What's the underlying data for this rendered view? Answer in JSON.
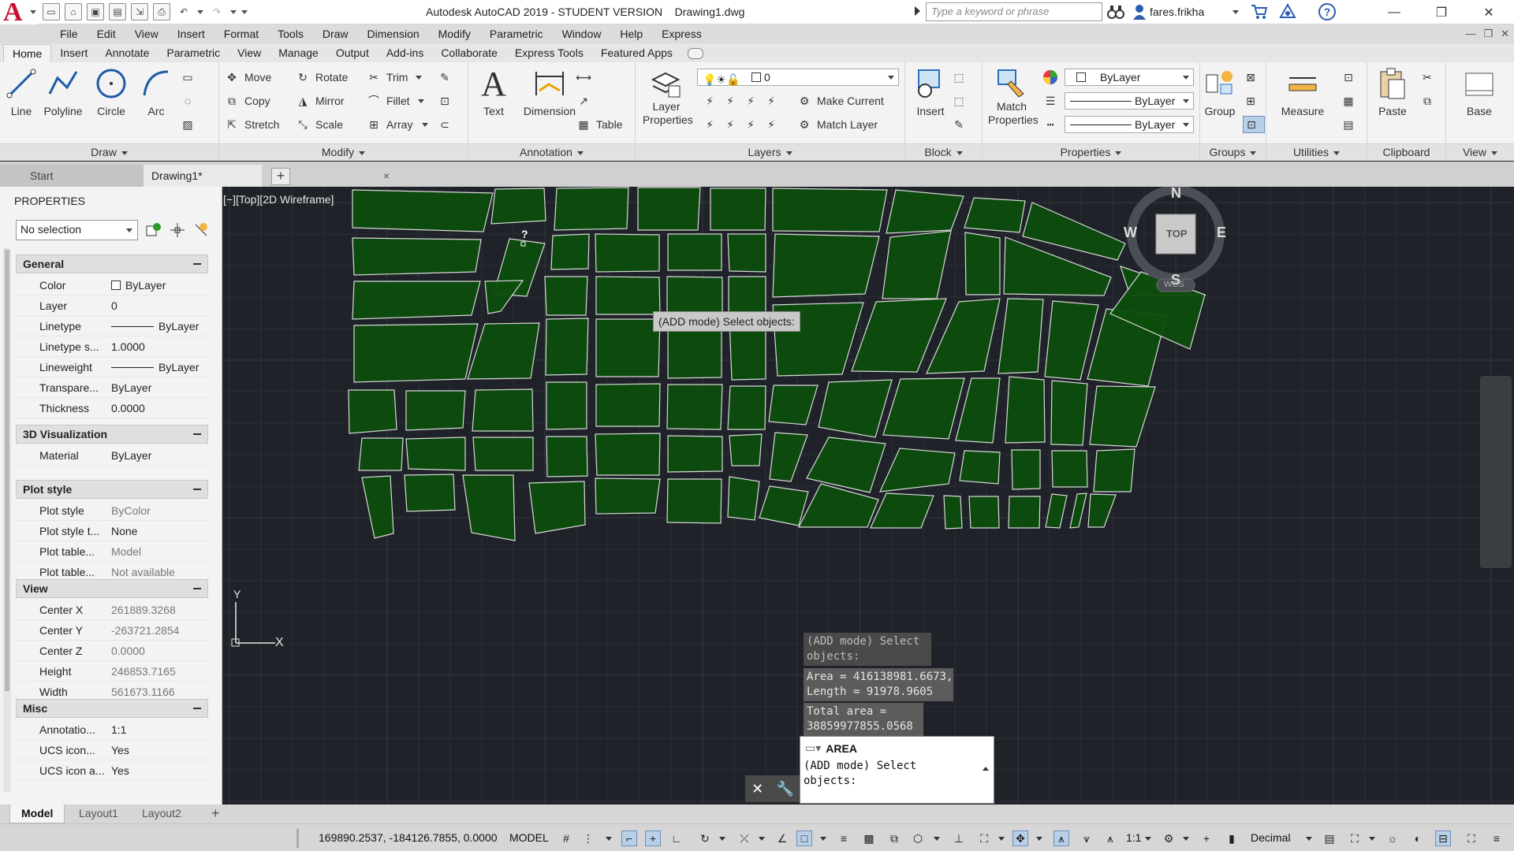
{
  "app": {
    "title": "Autodesk AutoCAD 2019 - STUDENT VERSION    Drawing1.dwg",
    "search_placeholder": "Type a keyword or phrase",
    "user": "fares.frikha",
    "brand_color": "#c8102e"
  },
  "menu": [
    "File",
    "Edit",
    "View",
    "Insert",
    "Format",
    "Tools",
    "Draw",
    "Dimension",
    "Modify",
    "Parametric",
    "Window",
    "Help",
    "Express"
  ],
  "ribbon_tabs": [
    "Home",
    "Insert",
    "Annotate",
    "Parametric",
    "View",
    "Manage",
    "Output",
    "Add-ins",
    "Collaborate",
    "Express Tools",
    "Featured Apps"
  ],
  "ribbon": {
    "draw": {
      "title": "Draw",
      "line": "Line",
      "polyline": "Polyline",
      "circle": "Circle",
      "arc": "Arc"
    },
    "modify": {
      "title": "Modify",
      "move": "Move",
      "rotate": "Rotate",
      "trim": "Trim",
      "copy": "Copy",
      "mirror": "Mirror",
      "fillet": "Fillet",
      "stretch": "Stretch",
      "scale": "Scale",
      "array": "Array"
    },
    "annotation": {
      "title": "Annotation",
      "text": "Text",
      "dimension": "Dimension",
      "table": "Table"
    },
    "layers": {
      "title": "Layers",
      "layer_properties": "Layer Properties",
      "current_layer": "0",
      "make_current": "Make Current",
      "match_layer": "Match Layer"
    },
    "block": {
      "title": "Block",
      "insert": "Insert"
    },
    "properties": {
      "title": "Properties",
      "match_properties": "Match Properties",
      "color": "ByLayer",
      "linetype": "ByLayer",
      "lineweight": "ByLayer"
    },
    "groups": {
      "title": "Groups",
      "group": "Group"
    },
    "utilities": {
      "title": "Utilities",
      "measure": "Measure"
    },
    "clipboard": {
      "title": "Clipboard",
      "paste": "Paste"
    },
    "view": {
      "title": "View",
      "base": "Base"
    }
  },
  "file_tabs": {
    "start": "Start",
    "drawing": "Drawing1*",
    "close": "×",
    "add": "+"
  },
  "properties_palette": {
    "title": "PROPERTIES",
    "selection": "No selection",
    "sections": {
      "general": {
        "title": "General",
        "rows": [
          {
            "k": "Color",
            "v": "ByLayer"
          },
          {
            "k": "Layer",
            "v": "0"
          },
          {
            "k": "Linetype",
            "v": "ByLayer"
          },
          {
            "k": "Linetype s...",
            "v": "1.0000"
          },
          {
            "k": "Lineweight",
            "v": "ByLayer"
          },
          {
            "k": "Transpare...",
            "v": "ByLayer"
          },
          {
            "k": "Thickness",
            "v": "0.0000"
          }
        ]
      },
      "viz": {
        "title": "3D Visualization",
        "rows": [
          {
            "k": "Material",
            "v": "ByLayer"
          }
        ]
      },
      "plot": {
        "title": "Plot style",
        "rows": [
          {
            "k": "Plot style",
            "v": "ByColor"
          },
          {
            "k": "Plot style t...",
            "v": "None"
          },
          {
            "k": "Plot table...",
            "v": "Model"
          },
          {
            "k": "Plot table...",
            "v": "Not available"
          }
        ]
      },
      "view": {
        "title": "View",
        "rows": [
          {
            "k": "Center X",
            "v": "261889.3268"
          },
          {
            "k": "Center Y",
            "v": "-263721.2854"
          },
          {
            "k": "Center Z",
            "v": "0.0000"
          },
          {
            "k": "Height",
            "v": "246853.7165"
          },
          {
            "k": "Width",
            "v": "561673.1166"
          }
        ]
      },
      "misc": {
        "title": "Misc",
        "rows": [
          {
            "k": "Annotatio...",
            "v": "1:1"
          },
          {
            "k": "UCS icon...",
            "v": "Yes"
          },
          {
            "k": "UCS icon a...",
            "v": "Yes"
          }
        ]
      }
    }
  },
  "viewport": {
    "label": "[−][Top][2D Wireframe]",
    "cursor_tooltip": "(ADD mode) Select objects:",
    "cursor_mark": "?",
    "history": [
      "(ADD mode) Select\nobjects:",
      "Area = 416138981.6673,\nLength = 91978.9605",
      "Total area =\n38859977855.0568"
    ],
    "command_name": "AREA",
    "command_prompt": "(ADD mode) Select\nobjects:",
    "compass": {
      "n": "N",
      "s": "S",
      "e": "E",
      "w": "W",
      "face": "TOP",
      "wcs": "WCS"
    },
    "ucs": {
      "x": "X",
      "y": "Y"
    },
    "fill_color": "#0d4d0d",
    "edge_color": "#d8d8d8"
  },
  "layout_tabs": [
    "Model",
    "Layout1",
    "Layout2"
  ],
  "status": {
    "coords": "169890.2537, -184126.7855, 0.0000",
    "space": "MODEL",
    "scale": "1:1",
    "units": "Decimal"
  }
}
